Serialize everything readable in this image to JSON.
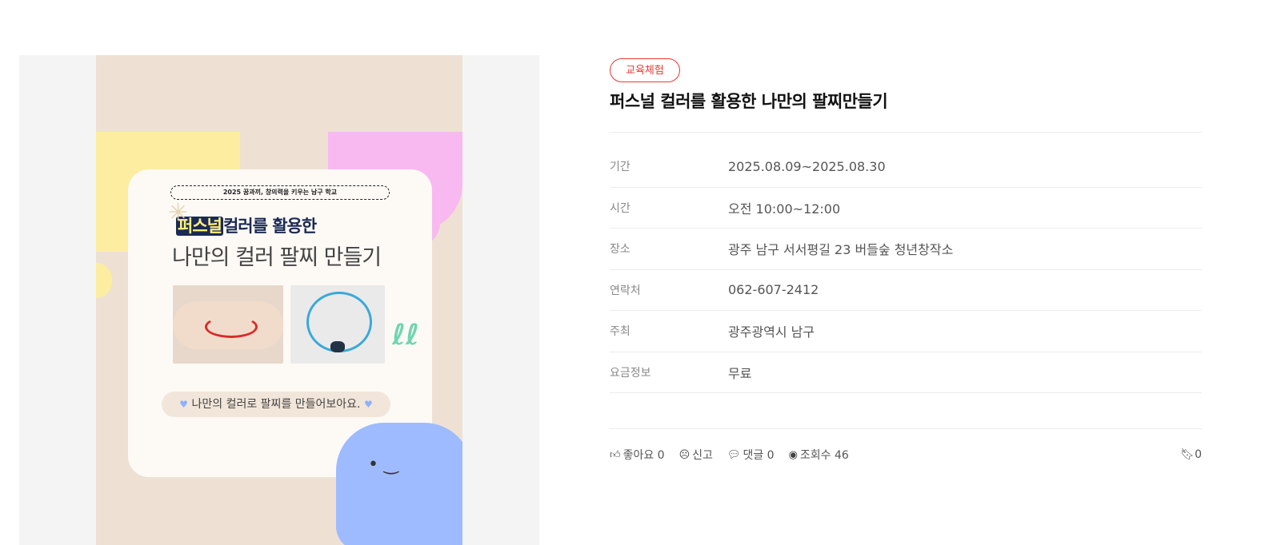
{
  "poster": {
    "subtitle": "2025 꿈과끼, 창의력을 키우는 남구 학교",
    "headline_highlight": "퍼스널",
    "headline_rest": "컬러를 활용한",
    "headline_main": "나만의 컬러 팔찌 만들기",
    "caption": "나만의 컬러로 팔찌를 만들어보아요."
  },
  "detail": {
    "category_tag": "교육체험",
    "title": "퍼스널 컬러를 활용한 나만의 팔찌만들기",
    "info": [
      {
        "label": "기간",
        "value": "2025.08.09~2025.08.30"
      },
      {
        "label": "시간",
        "value": "오전 10:00~12:00"
      },
      {
        "label": "장소",
        "value": "광주 남구 서서평길 23 버들숲 청년창작소"
      },
      {
        "label": "연락처",
        "value": "062-607-2412"
      },
      {
        "label": "주최",
        "value": "광주광역시 남구"
      },
      {
        "label": "요금정보",
        "value": "무료"
      }
    ]
  },
  "actions": {
    "like_label": "좋아요 0",
    "report_label": "신고",
    "comment_label": "댓글 0",
    "views_label": "조회수 46",
    "bookmark_count": "0"
  },
  "colors": {
    "accent_red": "#e53935",
    "poster_bg": "#eee1d4"
  }
}
